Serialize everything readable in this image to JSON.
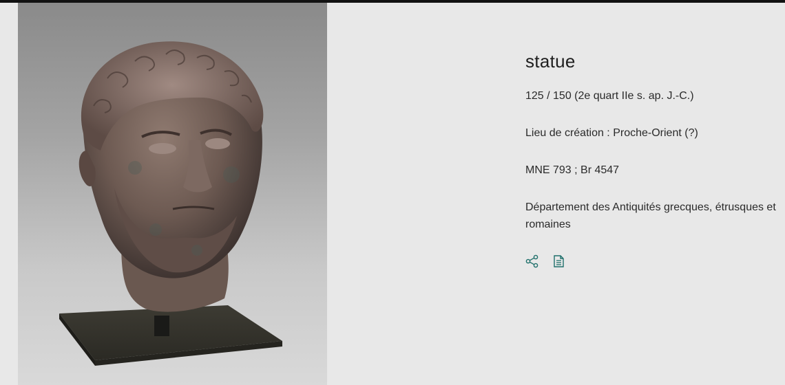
{
  "artwork": {
    "title": "statue",
    "date": "125 / 150 (2e quart IIe s. ap. J.-C.)",
    "place": "Lieu de création : Proche-Orient (?)",
    "inventory": "MNE 793 ; Br 4547",
    "department": "Département des Antiquités grecques, étrusques et romaines"
  },
  "actions": {
    "share_icon": "share-icon",
    "document_icon": "document-icon"
  },
  "colors": {
    "background": "#e8e8e8",
    "accent": "#1e6f6a",
    "text": "#2a2a2a"
  }
}
